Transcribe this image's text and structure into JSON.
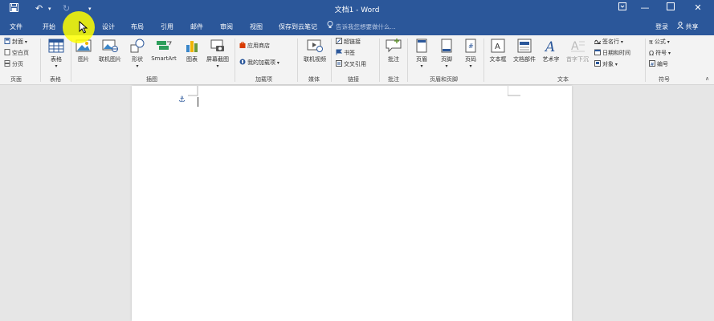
{
  "window": {
    "title": "文档1 - Word"
  },
  "tabs": [
    {
      "label": "文件"
    },
    {
      "label": "开始"
    },
    {
      "label": "设计"
    },
    {
      "label": "布局"
    },
    {
      "label": "引用"
    },
    {
      "label": "邮件"
    },
    {
      "label": "审阅"
    },
    {
      "label": "视图"
    },
    {
      "label": "保存到云笔记"
    }
  ],
  "tell_me": {
    "placeholder": "告诉我您想要做什么..."
  },
  "account": {
    "login": "登录",
    "share": "共享"
  },
  "ribbon": {
    "pages": {
      "cover": "封面",
      "blank": "空白页",
      "break": "分页",
      "group": "页面"
    },
    "tables": {
      "table": "表格",
      "group": "表格"
    },
    "illustrations": {
      "picture": "图片",
      "online_picture": "联机图片",
      "shapes": "形状",
      "smartart": "SmartArt",
      "chart": "图表",
      "screenshot": "屏幕截图",
      "group": "插图"
    },
    "addins": {
      "store": "应用商店",
      "my_addins": "我的加载项",
      "group": "加载项"
    },
    "media": {
      "online_video": "联机视频",
      "group": "媒体"
    },
    "links": {
      "hyperlink": "超链接",
      "bookmark": "书签",
      "cross_ref": "交叉引用",
      "group": "链接"
    },
    "comments": {
      "comment": "批注",
      "group": "批注"
    },
    "header_footer": {
      "header": "页眉",
      "footer": "页脚",
      "page_number": "页码",
      "group": "页眉和页脚"
    },
    "text": {
      "textbox": "文本框",
      "quick_parts": "文档部件",
      "wordart": "艺术字",
      "dropcap": "首字下沉",
      "signature": "签名行",
      "datetime": "日期和时间",
      "object": "对象",
      "group": "文本"
    },
    "symbols": {
      "equation": "公式",
      "symbol": "符号",
      "numbering": "编号",
      "group": "符号"
    }
  },
  "colors": {
    "accent": "#2b579a",
    "highlight": "#ffff00"
  }
}
